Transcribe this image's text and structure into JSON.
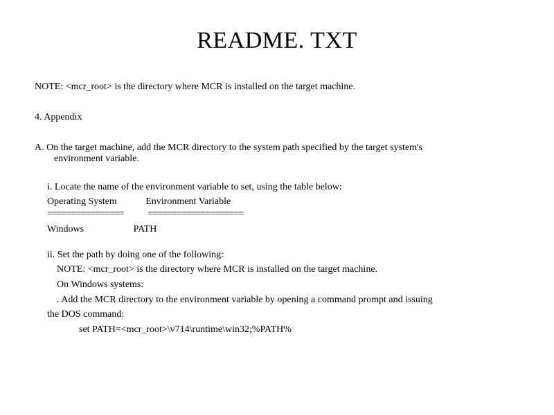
{
  "title": "README. TXT",
  "note": "NOTE: <mcr_root> is the directory where MCR is installed on the target machine.",
  "appendix_heading": "4. Appendix",
  "item_a_line1": "A. On the target machine, add the MCR directory to the system path  specified by the target system's",
  "item_a_line2": "environment variable.",
  "sub_i": "i. Locate the name of the environment variable to set, using the  table below:",
  "table_header_os": "Operating System",
  "table_header_env": "Environment Variable",
  "divider1": "================",
  "divider2": "====================",
  "table_row_os": "Windows",
  "table_row_env": "PATH",
  "sub_ii_line1": "ii. Set the path by doing one of the following:",
  "sub_ii_note": "NOTE: <mcr_root> is the directory where MCR is installed on the target machine.",
  "sub_ii_onwin": "On Windows systems:",
  "sub_ii_add": ". Add the MCR directory to the environment variable by opening a command prompt and issuing",
  "sub_ii_add2": "the DOS command:",
  "sub_ii_cmd": "set PATH=<mcr_root>\\v714\\runtime\\win32;%PATH%"
}
